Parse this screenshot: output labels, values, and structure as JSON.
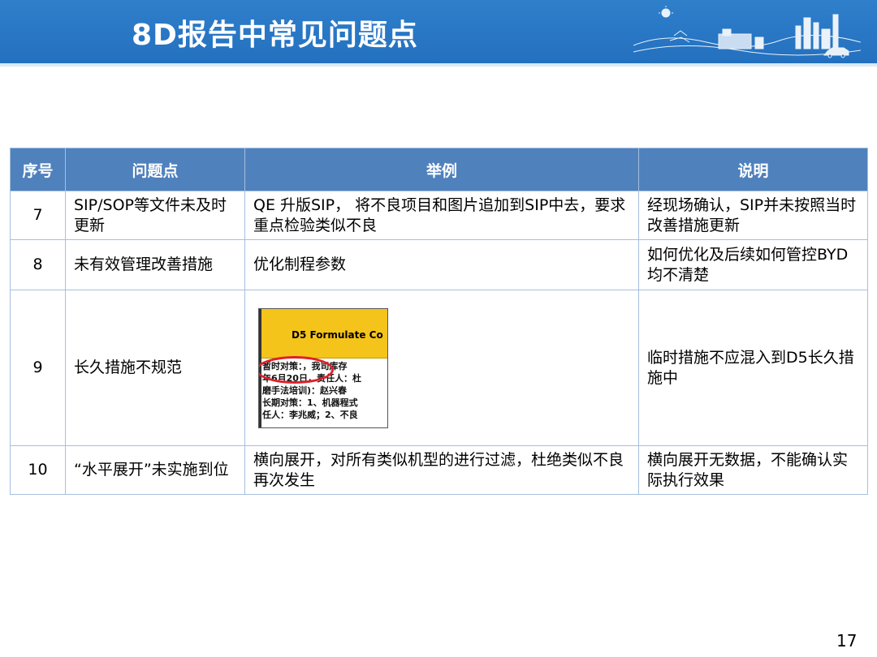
{
  "slide": {
    "title": "8D报告中常见问题点",
    "page_number": "17"
  },
  "table": {
    "headers": [
      "序号",
      "问题点",
      "举例",
      "说明"
    ],
    "rows": [
      {
        "no": "7",
        "issue": "SIP/SOP等文件未及时更新",
        "example": "QE 升版SIP， 将不良项目和图片追加到SIP中去，要求重点检验类似不良",
        "note": "经现场确认，SIP并未按照当时改善措施更新"
      },
      {
        "no": "8",
        "issue": "未有效管理改善措施",
        "example": "优化制程参数",
        "note": "如何优化及后续如何管控BYD均不清楚"
      },
      {
        "no": "9",
        "issue": "长久措施不规范",
        "example": "",
        "note": "临时措施不应混入到D5长久措施中"
      },
      {
        "no": "10",
        "issue": "“水平展开”未实施到位",
        "example": "横向展开，对所有类似机型的进行过滤，杜绝类似不良再次发生",
        "note": "横向展开无数据，不能确认实际执行效果"
      }
    ]
  },
  "example_image": {
    "header": "D5 Formulate Co",
    "lines": [
      "暂时对策：，我司库存",
      "年6月20日，责任人：杜",
      "磨手法培训)：赵兴春",
      "长期对策：1、机器程式",
      "任人：李兆威；2、不良"
    ],
    "highlight_color": "#e0202a",
    "header_color": "#f5c41a"
  },
  "colors": {
    "header_bg": "#2f7fcb",
    "table_header_bg": "#4f81bd",
    "table_border": "#a6bfe0"
  }
}
